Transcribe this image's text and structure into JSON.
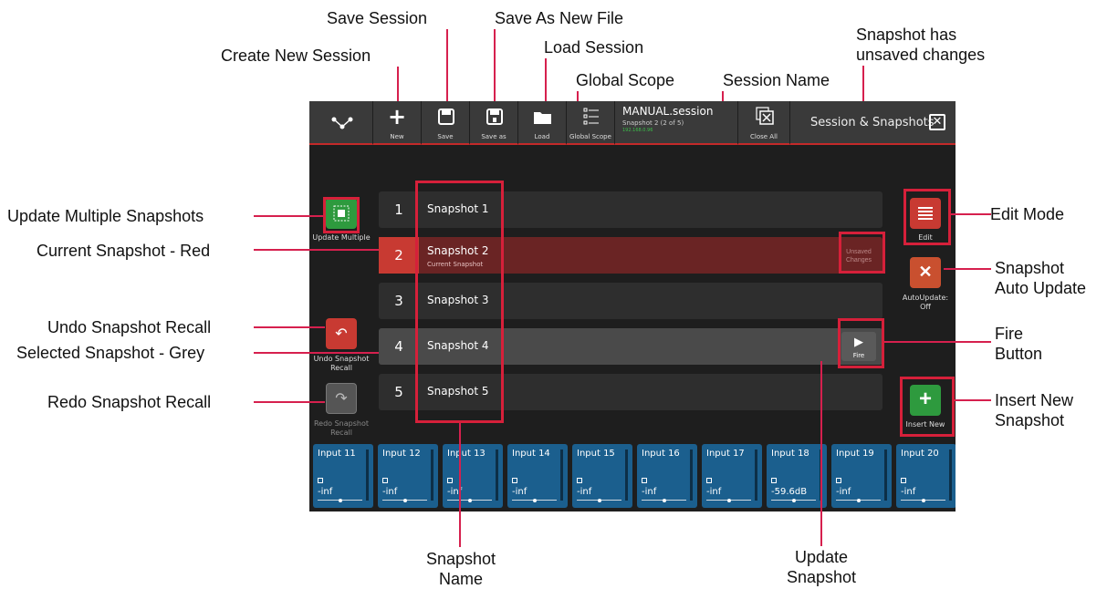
{
  "callouts": {
    "save_session": "Save Session",
    "save_as_new_file": "Save As New File",
    "create_new_session": "Create New Session",
    "load_session": "Load Session",
    "global_scope": "Global Scope",
    "session_name": "Session Name",
    "snapshot_unsaved_line1": "Snapshot has",
    "snapshot_unsaved_line2": "unsaved changes",
    "update_multiple": "Update Multiple Snapshots",
    "current_snapshot": "Current Snapshot - Red",
    "undo_recall": "Undo Snapshot Recall",
    "selected_snapshot": "Selected Snapshot - Grey",
    "redo_recall": "Redo Snapshot Recall",
    "edit_mode": "Edit Mode",
    "auto_update_line1": "Snapshot",
    "auto_update_line2": "Auto Update",
    "fire_line1": "Fire",
    "fire_line2": "Button",
    "insert_line1": "Insert New",
    "insert_line2": "Snapshot",
    "snapshot_name_line1": "Snapshot",
    "snapshot_name_line2": "Name",
    "update_snapshot_line1": "Update",
    "update_snapshot_line2": "Snapshot"
  },
  "toolbar": {
    "new_label": "New",
    "save_label": "Save",
    "save_as_label": "Save as",
    "load_label": "Load",
    "global_scope_label": "Global Scope",
    "session_title": "MANUAL.session",
    "session_subtitle": "Snapshot 2 (2 of 5)",
    "session_ip": "192.168.0.96",
    "close_all_label": "Close All",
    "panel_title": "Session & Snapshots"
  },
  "snapshots": [
    {
      "num": "1",
      "name": "Snapshot 1",
      "sub": ""
    },
    {
      "num": "2",
      "name": "Snapshot 2",
      "sub": "Current Snapshot"
    },
    {
      "num": "3",
      "name": "Snapshot 3",
      "sub": ""
    },
    {
      "num": "4",
      "name": "Snapshot 4",
      "sub": ""
    },
    {
      "num": "5",
      "name": "Snapshot 5",
      "sub": ""
    }
  ],
  "unsaved": {
    "line1": "Unsaved",
    "line2": "Changes"
  },
  "left_buttons": {
    "update_multiple": "Update Multiple",
    "undo_line1": "Undo Snapshot",
    "undo_line2": "Recall",
    "redo_line1": "Redo Snapshot",
    "redo_line2": "Recall"
  },
  "right_buttons": {
    "edit": "Edit",
    "autoupdate_line1": "AutoUpdate:",
    "autoupdate_line2": "Off",
    "fire": "Fire",
    "insert_new": "Insert New"
  },
  "channels": [
    {
      "name": "Input 11",
      "value": "-inf"
    },
    {
      "name": "Input 12",
      "value": "-inf"
    },
    {
      "name": "Input 13",
      "value": "-inf"
    },
    {
      "name": "Input 14",
      "value": "-inf"
    },
    {
      "name": "Input 15",
      "value": "-inf"
    },
    {
      "name": "Input 16",
      "value": "-inf"
    },
    {
      "name": "Input 17",
      "value": "-inf"
    },
    {
      "name": "Input 18",
      "value": "-59.6dB"
    },
    {
      "name": "Input 19",
      "value": "-inf"
    },
    {
      "name": "Input 20",
      "value": "-inf"
    }
  ],
  "colors": {
    "current_red": "#c83a32",
    "green": "#2e9a3e",
    "blue_strip": "#1b5f8e",
    "callout_red": "#d6203a"
  }
}
